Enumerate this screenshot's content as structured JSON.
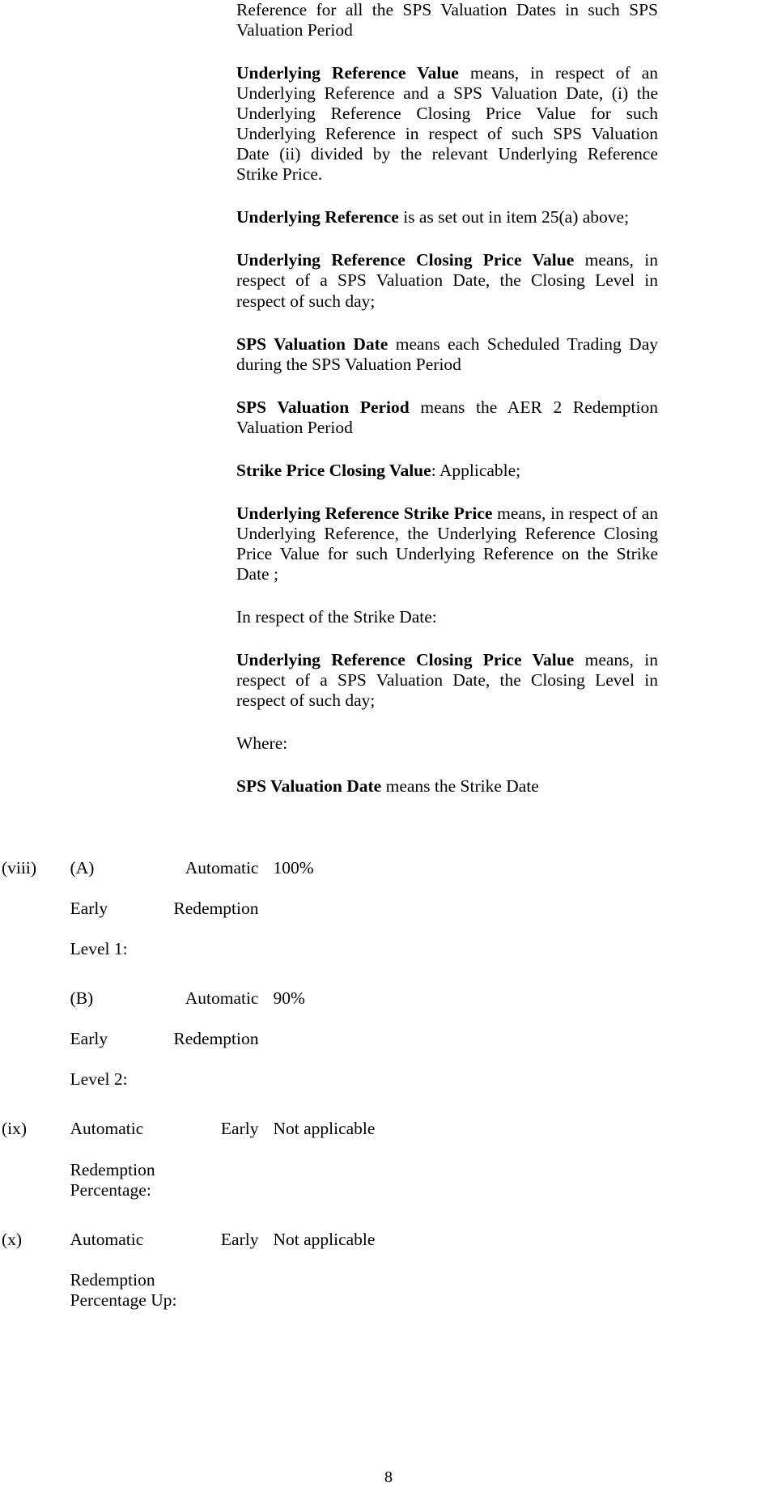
{
  "document": {
    "page_number": "8"
  },
  "definitions": [
    {
      "id": "underlying-reference-continuation",
      "bold_prefix": "",
      "text": "Reference for all the SPS Valuation Dates in such SPS Valuation Period",
      "justify": true
    },
    {
      "id": "underlying-reference-value",
      "bold_prefix": "Underlying Reference Value",
      "text": " means, in respect of an Underlying Reference and a SPS Valuation Date, (i) the Underlying Reference Closing Price Value for such Underlying Reference in respect of such SPS Valuation Date (ii) divided by the relevant Underlying Reference Strike Price.",
      "justify": true
    },
    {
      "id": "underlying-reference",
      "bold_prefix": "Underlying Reference",
      "text": " is as set out in item 25(a) above;",
      "justify": false
    },
    {
      "id": "underlying-reference-closing-price-value-1",
      "bold_prefix": "Underlying Reference Closing Price Value",
      "text": " means, in respect of a SPS Valuation Date, the Closing Level in respect of such day;",
      "justify": true
    },
    {
      "id": "sps-valuation-date-1",
      "bold_prefix": "SPS Valuation Date",
      "text": " means each Scheduled Trading Day during the SPS Valuation Period",
      "justify": true
    },
    {
      "id": "sps-valuation-period",
      "bold_prefix": "SPS Valuation Period",
      "text": " means the AER 2 Redemption Valuation Period",
      "justify": true
    },
    {
      "id": "strike-price-closing-value",
      "bold_prefix": "Strike Price Closing Value",
      "text": ": Applicable;",
      "justify": false
    },
    {
      "id": "underlying-reference-strike-price",
      "bold_prefix": "Underlying Reference Strike Price",
      "text": " means, in respect of an Underlying Reference, the Underlying Reference Closing Price Value for such Underlying Reference on the Strike Date ;",
      "justify": true
    },
    {
      "id": "in-respect-of-strike-date",
      "bold_prefix": "",
      "text": "In respect of the Strike Date:",
      "justify": false
    },
    {
      "id": "underlying-reference-closing-price-value-2",
      "bold_prefix": "Underlying Reference Closing Price Value",
      "text": " means, in respect of a SPS Valuation Date, the Closing Level  in respect of such day;",
      "justify": true
    },
    {
      "id": "where-label",
      "bold_prefix": "",
      "text": "Where:",
      "justify": false
    },
    {
      "id": "sps-valuation-date-2",
      "bold_prefix": "SPS Valuation Date",
      "text": " means the Strike Date",
      "justify": false
    }
  ],
  "items": [
    {
      "number": "(viii)",
      "label_lines": [
        "(A) Automatic",
        "Early Redemption",
        "Level 1:"
      ],
      "label_plain": "(A) Automatic Early Redemption Level 1:",
      "value": "100%"
    },
    {
      "number": "",
      "label_lines": [
        "(B) Automatic",
        "Early Redemption",
        "Level 2:"
      ],
      "label_plain": "(B) Automatic Early Redemption Level 2:",
      "value": "90%"
    },
    {
      "number": "(ix)",
      "label_lines": [
        "Automatic Early",
        "Redemption",
        "Percentage:"
      ],
      "label_plain": "Automatic Early Redemption Percentage:",
      "value": "Not applicable"
    },
    {
      "number": "(x)",
      "label_lines": [
        "Automatic Early",
        "Redemption",
        "Percentage Up:"
      ],
      "label_plain": "Automatic Early Redemption Percentage Up:",
      "value": "Not applicable"
    }
  ]
}
